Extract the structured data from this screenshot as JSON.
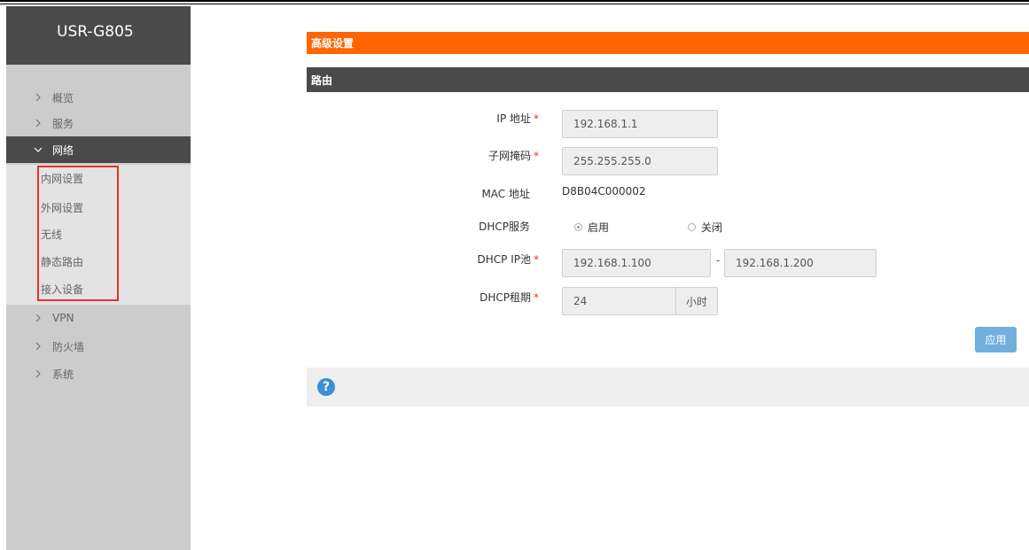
{
  "sidebar": {
    "brand": "USR-G805",
    "items": [
      {
        "label": "概览"
      },
      {
        "label": "服务"
      },
      {
        "label": "网络"
      },
      {
        "label": "VPN"
      },
      {
        "label": "防火墙"
      },
      {
        "label": "系统"
      }
    ],
    "network_submenu": [
      {
        "label": "内网设置"
      },
      {
        "label": "外网设置"
      },
      {
        "label": "无线"
      },
      {
        "label": "静态路由"
      },
      {
        "label": "接入设备"
      }
    ],
    "highlight_color": "#e0322f"
  },
  "header": {
    "section_title": "高级设置",
    "panel_title": "路由",
    "accent_color": "#ff6600"
  },
  "form": {
    "ip_label": "IP 地址",
    "ip_value": "192.168.1.1",
    "netmask_label": "子网掩码",
    "netmask_value": "255.255.255.0",
    "mac_label": "MAC 地址",
    "mac_value": "D8B04C000002",
    "dhcp_label": "DHCP服务",
    "dhcp_on": "启用",
    "dhcp_off": "关闭",
    "dhcp_pool_label": "DHCP IP池",
    "dhcp_pool_start": "192.168.1.100",
    "dhcp_pool_sep": "-",
    "dhcp_pool_end": "192.168.1.200",
    "lease_label": "DHCP租期",
    "lease_value": "24",
    "lease_unit": "小时",
    "required_mark": "*",
    "apply_label": "应用"
  },
  "help": {
    "icon": "question-icon",
    "symbol": "?"
  }
}
